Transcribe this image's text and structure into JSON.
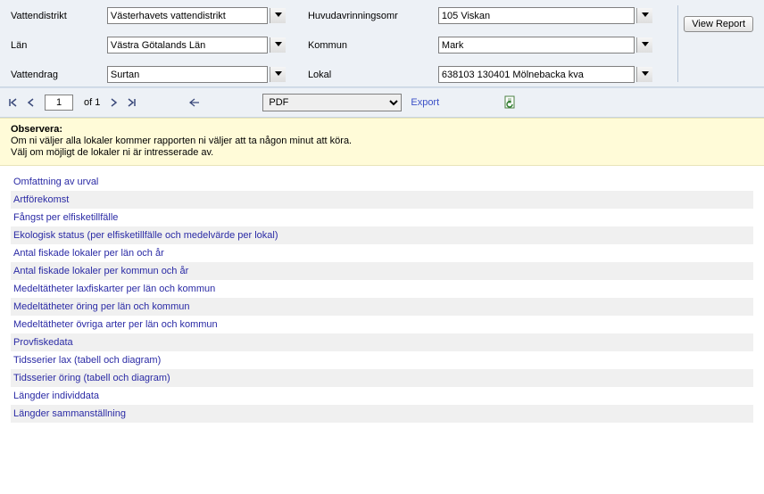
{
  "params": {
    "labels": {
      "vattendistrikt": "Vattendistrikt",
      "huvudavrinning": "Huvudavrinningsomr",
      "lan": "Län",
      "kommun": "Kommun",
      "vattendrag": "Vattendrag",
      "lokal": "Lokal"
    },
    "values": {
      "vattendistrikt": "Västerhavets vattendistrikt",
      "huvudavrinning": "105 Viskan",
      "lan": "Västra Götalands Län",
      "kommun": "Mark",
      "vattendrag": "Surtan",
      "lokal": "638103 130401 Mölnebacka kva"
    },
    "view_report": "View Report"
  },
  "toolbar": {
    "page_value": "1",
    "of_label": "of 1",
    "export_format": "PDF",
    "export_label": "Export"
  },
  "notice": {
    "title": "Observera:",
    "line1": "Om ni väljer alla lokaler kommer rapporten ni väljer att ta någon minut att köra.",
    "line2": "Välj om möjligt de lokaler ni är intresserade av."
  },
  "report_links": [
    "Omfattning av urval",
    "Artförekomst",
    "Fångst per elfisketillfälle",
    "Ekologisk status (per elfisketillfälle och medelvärde per lokal)",
    "Antal fiskade lokaler per län och år",
    "Antal fiskade lokaler per kommun och år",
    "Medeltätheter laxfiskarter per län och kommun",
    "Medeltätheter öring per län och kommun",
    "Medeltätheter övriga arter per län och kommun",
    "Provfiskedata",
    "Tidsserier lax (tabell och diagram)",
    "Tidsserier öring (tabell och diagram)",
    "Längder individdata",
    "Längder sammanställning"
  ]
}
